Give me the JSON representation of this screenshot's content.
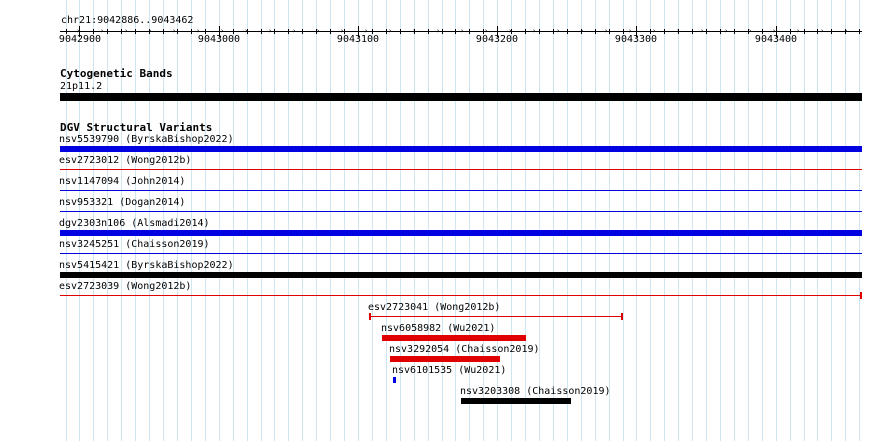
{
  "location": "chr21:9042886..9043462",
  "ruler": {
    "start": 9042886,
    "end": 9043462,
    "major_ticks": [
      {
        "pos": 9042900,
        "label": "9042900"
      },
      {
        "pos": 9043000,
        "label": "9043000"
      },
      {
        "pos": 9043100,
        "label": "9043100"
      },
      {
        "pos": 9043200,
        "label": "9043200"
      },
      {
        "pos": 9043300,
        "label": "9043300"
      },
      {
        "pos": 9043400,
        "label": "9043400"
      }
    ]
  },
  "tracks": {
    "cytoband": {
      "title": "Cytogenetic Bands",
      "band_label": "21p11.2",
      "color": "#000000"
    },
    "dgv": {
      "title": "DGV Structural Variants",
      "features": [
        {
          "label": "nsv5539790 (ByrskaBishop2022)",
          "start": 9042886,
          "end": 9043462,
          "color": "#0000e0",
          "style": "thick"
        },
        {
          "label": "esv2723012 (Wong2012b)",
          "start": 9042886,
          "end": 9043462,
          "color": "#e00000",
          "style": "thin"
        },
        {
          "label": "nsv1147094 (John2014)",
          "start": 9042886,
          "end": 9043462,
          "color": "#0000e0",
          "style": "thin"
        },
        {
          "label": "nsv953321 (Dogan2014)",
          "start": 9042886,
          "end": 9043462,
          "color": "#0000e0",
          "style": "thin"
        },
        {
          "label": "dgv2303n106 (Alsmadi2014)",
          "start": 9042886,
          "end": 9043462,
          "color": "#0000e0",
          "style": "thick"
        },
        {
          "label": "nsv3245251 (Chaisson2019)",
          "start": 9042886,
          "end": 9043462,
          "color": "#0000e0",
          "style": "thin"
        },
        {
          "label": "nsv5415421 (ByrskaBishop2022)",
          "start": 9042886,
          "end": 9043462,
          "color": "#000000",
          "style": "thick"
        },
        {
          "label": "esv2723039 (Wong2012b)",
          "start": 9042886,
          "end": 9043462,
          "color": "#e00000",
          "style": "thin",
          "endcaps": "right"
        },
        {
          "label": "esv2723041 (Wong2012b)",
          "start": 9043108,
          "end": 9043290,
          "color": "#e00000",
          "style": "thin",
          "endcaps": "both"
        },
        {
          "label": "nsv6058982 (Wu2021)",
          "start": 9043117,
          "end": 9043221,
          "color": "#e00000",
          "style": "thick"
        },
        {
          "label": "nsv3292054 (Chaisson2019)",
          "start": 9043123,
          "end": 9043202,
          "color": "#e00000",
          "style": "thick"
        },
        {
          "label": "nsv6101535 (Wu2021)",
          "start": 9043125,
          "end": 9043127,
          "color": "#0000e0",
          "style": "thick"
        },
        {
          "label": "nsv3203308 (Chaisson2019)",
          "start": 9043174,
          "end": 9043253,
          "color": "#000000",
          "style": "thick"
        }
      ]
    }
  }
}
